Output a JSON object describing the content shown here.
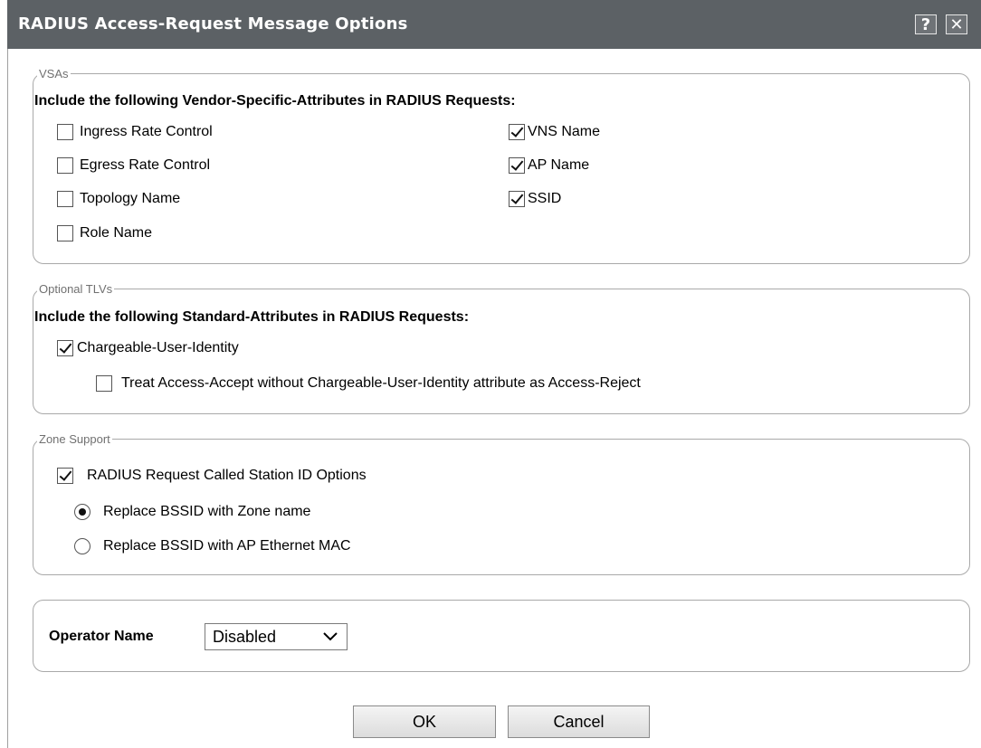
{
  "dialog": {
    "title": "RADIUS Access-Request Message Options",
    "help_icon": "help-icon",
    "close_icon": "close-icon"
  },
  "vsas": {
    "legend": "VSAs",
    "heading": "Include the following Vendor-Specific-Attributes in RADIUS Requests:",
    "items": [
      {
        "label": "Ingress Rate Control",
        "checked": false
      },
      {
        "label": "Egress Rate Control",
        "checked": false
      },
      {
        "label": "Topology Name",
        "checked": false
      },
      {
        "label": "Role Name",
        "checked": false
      },
      {
        "label": "VNS Name",
        "checked": true
      },
      {
        "label": "AP Name",
        "checked": true
      },
      {
        "label": "SSID",
        "checked": true
      }
    ]
  },
  "tlvs": {
    "legend": "Optional TLVs",
    "heading": "Include the following Standard-Attributes in RADIUS Requests:",
    "cui": {
      "label": "Chargeable-User-Identity",
      "checked": true
    },
    "treat": {
      "label": "Treat Access-Accept without Chargeable-User-Identity attribute as Access-Reject",
      "checked": false
    }
  },
  "zone": {
    "legend": "Zone Support",
    "called_station": {
      "label": "RADIUS Request Called Station ID Options",
      "checked": true
    },
    "options": [
      {
        "label": "Replace BSSID with Zone name",
        "selected": true
      },
      {
        "label": "Replace BSSID with AP Ethernet MAC",
        "selected": false
      }
    ]
  },
  "operator": {
    "label": "Operator Name",
    "value": "Disabled"
  },
  "buttons": {
    "ok": "OK",
    "cancel": "Cancel"
  },
  "colors": {
    "titlebar": "#5c6165",
    "border": "#a9a9a9"
  }
}
